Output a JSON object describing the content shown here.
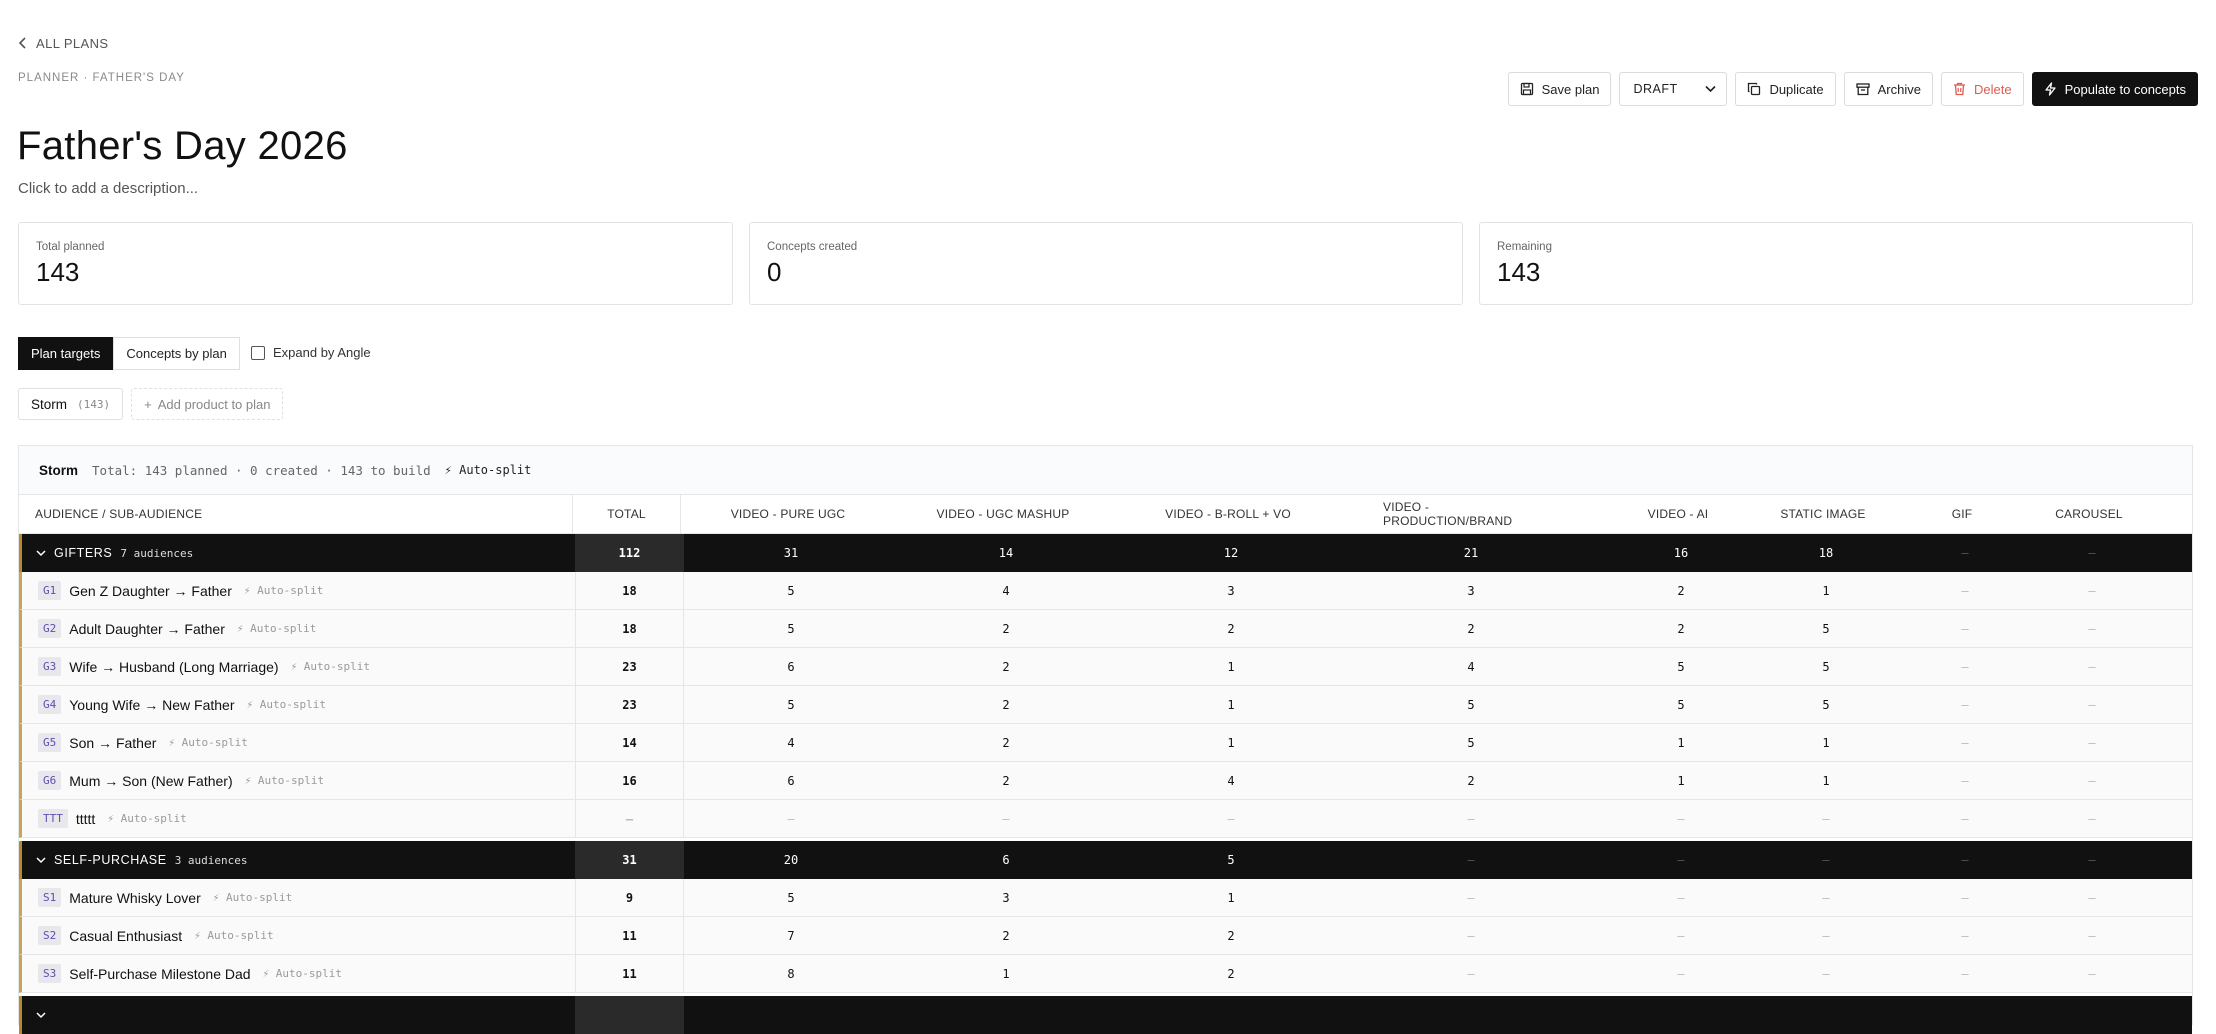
{
  "nav": {
    "back_label": "ALL PLANS",
    "breadcrumb": "PLANNER · FATHER'S DAY"
  },
  "page": {
    "title": "Father's Day 2026",
    "description": "Click to add a description..."
  },
  "actions": {
    "save": "Save plan",
    "status": "DRAFT",
    "duplicate": "Duplicate",
    "archive": "Archive",
    "delete": "Delete",
    "populate": "Populate to concepts"
  },
  "stats": [
    {
      "label": "Total planned",
      "value": "143"
    },
    {
      "label": "Concepts created",
      "value": "0"
    },
    {
      "label": "Remaining",
      "value": "143"
    }
  ],
  "tabs": {
    "plan_targets": "Plan targets",
    "concepts_by_plan": "Concepts by plan"
  },
  "expand_label": "Expand by Angle",
  "products": {
    "storm_label": "Storm",
    "storm_count": "(143)",
    "add_label": "Add product to plan"
  },
  "panel": {
    "product": "Storm",
    "summary": "Total: 143 planned · 0 created · 143 to build",
    "auto_split": "⚡ Auto-split"
  },
  "columns": {
    "audience": "AUDIENCE / SUB-AUDIENCE",
    "total": "TOTAL",
    "formats": [
      "VIDEO - PURE UGC",
      "VIDEO - UGC MASHUP",
      "VIDEO - B-ROLL + VO",
      "VIDEO - PRODUCTION/BRAND",
      "VIDEO - AI",
      "STATIC IMAGE",
      "GIF",
      "CAROUSEL"
    ]
  },
  "auto_split_tag": "⚡ Auto-split",
  "groups": [
    {
      "name": "GIFTERS",
      "count": "7 audiences",
      "total": "112",
      "values": [
        "31",
        "14",
        "12",
        "21",
        "16",
        "18",
        "–",
        "–"
      ],
      "rows": [
        {
          "code": "G1",
          "name": "Gen Z Daughter → Father",
          "total": "18",
          "values": [
            "5",
            "4",
            "3",
            "3",
            "2",
            "1",
            "–",
            "–"
          ]
        },
        {
          "code": "G2",
          "name": "Adult Daughter → Father",
          "total": "18",
          "values": [
            "5",
            "2",
            "2",
            "2",
            "2",
            "5",
            "–",
            "–"
          ]
        },
        {
          "code": "G3",
          "name": "Wife → Husband (Long Marriage)",
          "total": "23",
          "values": [
            "6",
            "2",
            "1",
            "4",
            "5",
            "5",
            "–",
            "–"
          ]
        },
        {
          "code": "G4",
          "name": "Young Wife → New Father",
          "total": "23",
          "values": [
            "5",
            "2",
            "1",
            "5",
            "5",
            "5",
            "–",
            "–"
          ]
        },
        {
          "code": "G5",
          "name": "Son → Father",
          "total": "14",
          "values": [
            "4",
            "2",
            "1",
            "5",
            "1",
            "1",
            "–",
            "–"
          ]
        },
        {
          "code": "G6",
          "name": "Mum → Son (New Father)",
          "total": "16",
          "values": [
            "6",
            "2",
            "4",
            "2",
            "1",
            "1",
            "–",
            "–"
          ]
        },
        {
          "code": "TTT",
          "name": "ttttt",
          "total": "–",
          "values": [
            "–",
            "–",
            "–",
            "–",
            "–",
            "–",
            "–",
            "–"
          ]
        }
      ]
    },
    {
      "name": "SELF-PURCHASE",
      "count": "3 audiences",
      "total": "31",
      "values": [
        "20",
        "6",
        "5",
        "–",
        "–",
        "–",
        "–",
        "–"
      ],
      "rows": [
        {
          "code": "S1",
          "name": "Mature Whisky Lover",
          "total": "9",
          "values": [
            "5",
            "3",
            "1",
            "–",
            "–",
            "–",
            "–",
            "–"
          ]
        },
        {
          "code": "S2",
          "name": "Casual Enthusiast",
          "total": "11",
          "values": [
            "7",
            "2",
            "2",
            "–",
            "–",
            "–",
            "–",
            "–"
          ]
        },
        {
          "code": "S3",
          "name": "Self-Purchase Milestone Dad",
          "total": "11",
          "values": [
            "8",
            "1",
            "2",
            "–",
            "–",
            "–",
            "–",
            "–"
          ]
        }
      ]
    },
    {
      "name": "",
      "count": "",
      "total": "",
      "values": [
        "",
        "",
        "",
        "",
        "",
        "",
        "",
        ""
      ],
      "rows": []
    }
  ]
}
